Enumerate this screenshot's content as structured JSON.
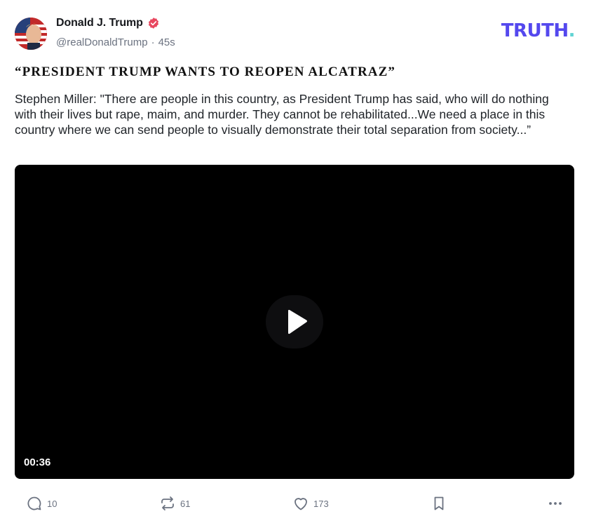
{
  "author": {
    "display_name": "Donald J. Trump",
    "handle": "@realDonaldTrump",
    "separator": "·",
    "time_ago": "45s",
    "verified": true
  },
  "brand": {
    "logo_text": "TRUTH",
    "logo_dot": ".",
    "color": "#5448ee",
    "dot_color": "#5fd3d3"
  },
  "post": {
    "title": "“PRESIDENT TRUMP WANTS TO REOPEN ALCATRAZ”",
    "body": "Stephen Miller: \"There are people in this country, as President Trump has said, who will do nothing with their lives but rape, maim, and murder. They cannot be rehabilitated...We need a place in this country where we can send people to visually demonstrate their total separation from society...”"
  },
  "video": {
    "duration": "00:36",
    "icon": "play-icon"
  },
  "actions": {
    "reply": {
      "icon": "comment-icon",
      "count": "10"
    },
    "retruth": {
      "icon": "retruth-icon",
      "count": "61"
    },
    "like": {
      "icon": "heart-icon",
      "count": "173"
    },
    "bookmark": {
      "icon": "bookmark-icon"
    },
    "more": {
      "icon": "more-icon"
    }
  },
  "colors": {
    "verified_badge": "#e8475f",
    "muted_text": "#6b7280",
    "video_bg": "#000000"
  }
}
